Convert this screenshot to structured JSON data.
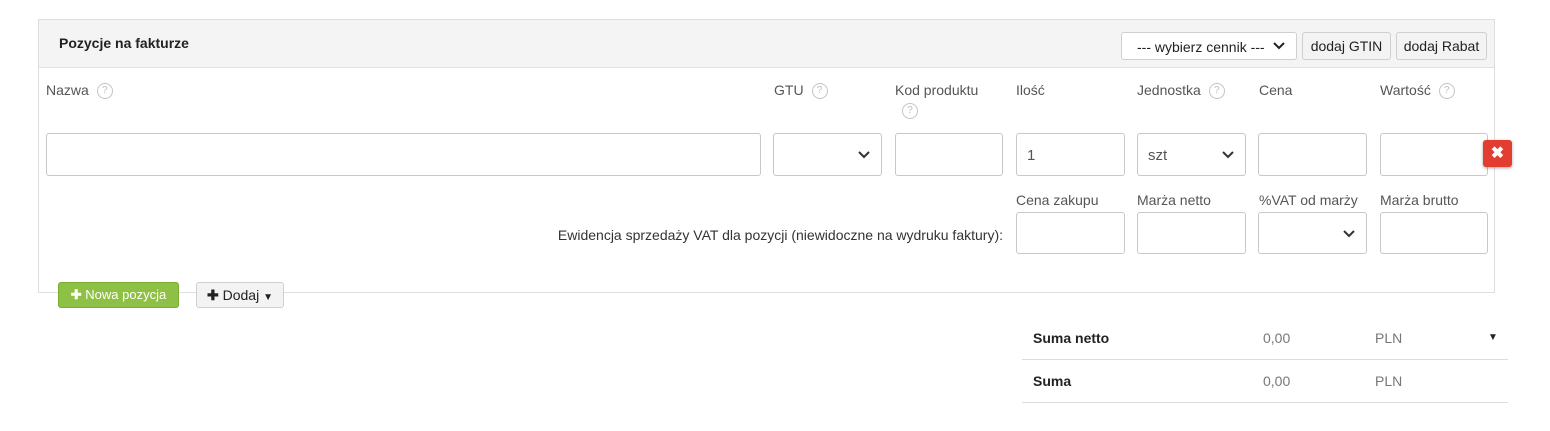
{
  "panel": {
    "title": "Pozycje na fakturze",
    "pricelist_select": "--- wybierz cennik ---",
    "add_gtin_label": "dodaj GTIN",
    "add_discount_label": "dodaj Rabat"
  },
  "columns": {
    "name": "Nazwa",
    "gtu": "GTU",
    "product_code": "Kod produktu",
    "quantity": "Ilość",
    "unit": "Jednostka",
    "price": "Cena",
    "value": "Wartość"
  },
  "row": {
    "name_value": "",
    "gtu_value": "",
    "product_code_value": "",
    "quantity_value": "1",
    "unit_value": "szt",
    "price_value": "",
    "value_value": ""
  },
  "vat_record": {
    "label": "Ewidencja sprzedaży VAT dla pozycji (niewidoczne na wydruku faktury):",
    "purchase_price": "Cena zakupu",
    "net_margin": "Marża netto",
    "vat_of_margin": "%VAT od marży",
    "gross_margin": "Marża brutto"
  },
  "actions": {
    "new_item": "Nowa pozycja",
    "add": "Dodaj"
  },
  "summary": [
    {
      "label": "Suma netto",
      "value": "0,00",
      "currency": "PLN"
    },
    {
      "label": "Suma",
      "value": "0,00",
      "currency": "PLN"
    }
  ],
  "icons": {
    "help": "question-circle-icon",
    "delete": "close-icon",
    "plus": "plus-icon",
    "caret": "caret-down-icon",
    "chevron": "chevron-down-icon"
  },
  "colors": {
    "accent_green": "#8dc044",
    "delete_red": "#e23d30"
  }
}
